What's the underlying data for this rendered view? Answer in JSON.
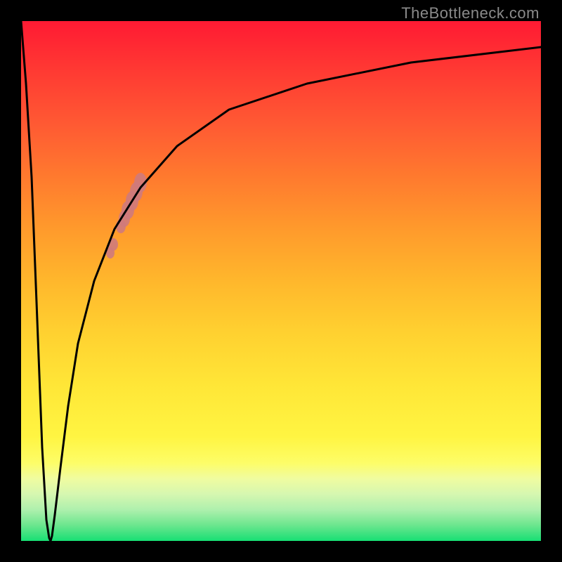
{
  "attribution": "TheBottleneck.com",
  "colors": {
    "curve_stroke": "#000000",
    "annotation_dots": "#cf7a7c",
    "frame": "#000000"
  },
  "chart_data": {
    "type": "line",
    "title": "",
    "xlabel": "",
    "ylabel": "",
    "xlim": [
      0,
      1
    ],
    "ylim": [
      0,
      1
    ],
    "note": "No axis ticks or numeric labels are rendered. x/y are in normalized plot-area coordinates (0=left/top edge of gradient box, 1=right/bottom). The visible curve drops sharply from top-left to a narrow minimum near x≈0.056 at y≈1.0 (bottom), then rises steeply, asymptotically approaching y≈0.05 (near top) toward the right edge. A cluster of salmon-pink marker strokes lies along the ascending branch roughly between x 0.16–0.24.",
    "series": [
      {
        "name": "bottleneck-curve",
        "x": [
          0.0,
          0.01,
          0.02,
          0.03,
          0.041,
          0.049,
          0.054,
          0.056,
          0.06,
          0.065,
          0.075,
          0.09,
          0.11,
          0.14,
          0.18,
          0.23,
          0.3,
          0.4,
          0.55,
          0.75,
          1.0
        ],
        "y": [
          0.0,
          0.12,
          0.3,
          0.54,
          0.82,
          0.96,
          0.995,
          1.0,
          0.99,
          0.95,
          0.86,
          0.74,
          0.62,
          0.5,
          0.4,
          0.32,
          0.24,
          0.17,
          0.12,
          0.08,
          0.05
        ]
      }
    ],
    "annotations": [
      {
        "name": "highlight-blob-upper",
        "approx_x_range": [
          0.185,
          0.24
        ],
        "approx_y_range": [
          0.3,
          0.4
        ],
        "color": "#cf7a7c"
      },
      {
        "name": "highlight-blob-lower",
        "approx_x_range": [
          0.165,
          0.185
        ],
        "approx_y_range": [
          0.42,
          0.46
        ],
        "color": "#cf7a7c"
      }
    ]
  }
}
